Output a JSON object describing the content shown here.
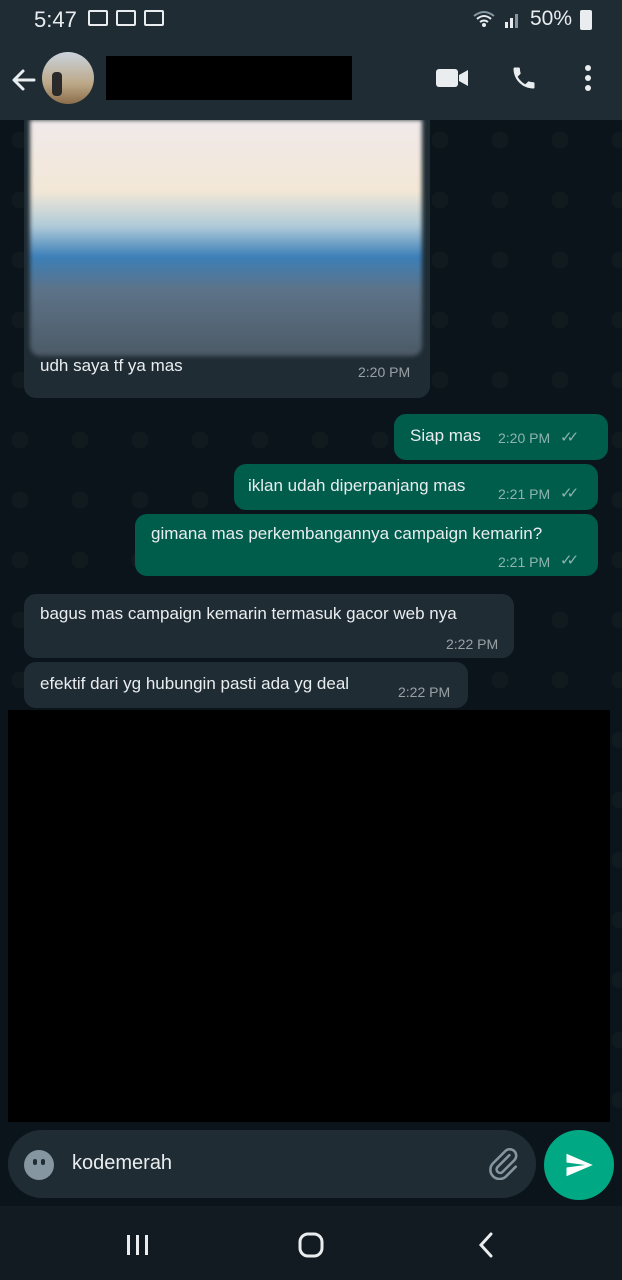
{
  "status_bar": {
    "time": "5:47",
    "battery": "50%"
  },
  "header": {
    "icons": [
      "back-arrow-icon",
      "video-call-icon",
      "voice-call-icon",
      "more-vert-icon"
    ]
  },
  "messages": [
    {
      "dir": "in",
      "text": "udh saya tf ya mas",
      "time": "2:20 PM",
      "has_image": true
    },
    {
      "dir": "out",
      "text": "Siap mas",
      "time": "2:20 PM",
      "ticks": "✓✓"
    },
    {
      "dir": "out",
      "text": "iklan udah diperpanjang mas",
      "time": "2:21 PM",
      "ticks": "✓✓"
    },
    {
      "dir": "out",
      "text": "gimana mas perkembangannya campaign kemarin?",
      "time": "2:21 PM",
      "ticks": "✓✓"
    },
    {
      "dir": "in",
      "text": "bagus mas campaign kemarin termasuk gacor web nya",
      "time": "2:22 PM"
    },
    {
      "dir": "in",
      "text": "efektif dari yg hubungin pasti ada yg deal",
      "time": "2:22 PM"
    }
  ],
  "composer": {
    "value": "kodemerah"
  },
  "colors": {
    "outgoing": "#005c4b",
    "incoming": "#1f2c34",
    "accent": "#00a884",
    "background": "#0b141a"
  }
}
